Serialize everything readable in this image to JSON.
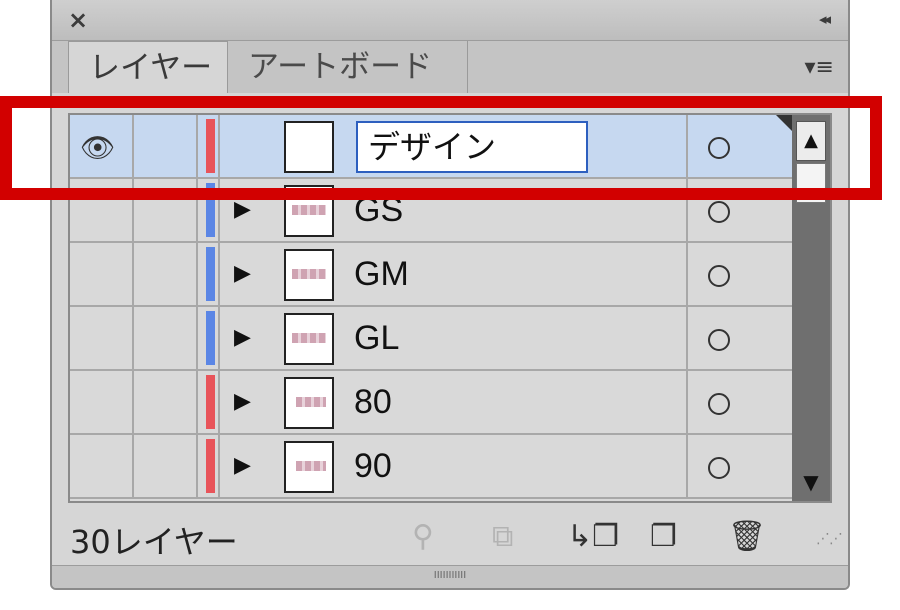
{
  "tabs": [
    {
      "label": "レイヤー",
      "active": true
    },
    {
      "label": "アートボード",
      "active": false
    }
  ],
  "layers": [
    {
      "name": "デザイン",
      "color": "#e8545a",
      "editing": true,
      "expandable": false,
      "visible": true
    },
    {
      "name": "GS",
      "color": "#5b86e5",
      "editing": false,
      "expandable": true,
      "visible": false
    },
    {
      "name": "GM",
      "color": "#5b86e5",
      "editing": false,
      "expandable": true,
      "visible": false
    },
    {
      "name": "GL",
      "color": "#5b86e5",
      "editing": false,
      "expandable": true,
      "visible": false
    },
    {
      "name": "80",
      "color": "#e8545a",
      "editing": false,
      "expandable": true,
      "visible": false
    },
    {
      "name": "90",
      "color": "#e8545a",
      "editing": false,
      "expandable": true,
      "visible": false
    }
  ],
  "footer": {
    "layer_count": "30レイヤー"
  },
  "icons": {
    "close": "close-icon",
    "collapse": "collapse-icon",
    "menu": "panel-menu-icon",
    "eye": "eye-icon",
    "expand": "disclosure-triangle-icon",
    "target": "target-circle-icon",
    "search": "search-icon",
    "clip": "clipping-mask-icon",
    "sublayer": "new-sublayer-icon",
    "newlayer": "new-layer-icon",
    "trash": "trash-icon"
  },
  "accent": {
    "highlight_frame": "#d20000",
    "selection": "#c6d8f0",
    "input_border": "#2d5fbf"
  }
}
